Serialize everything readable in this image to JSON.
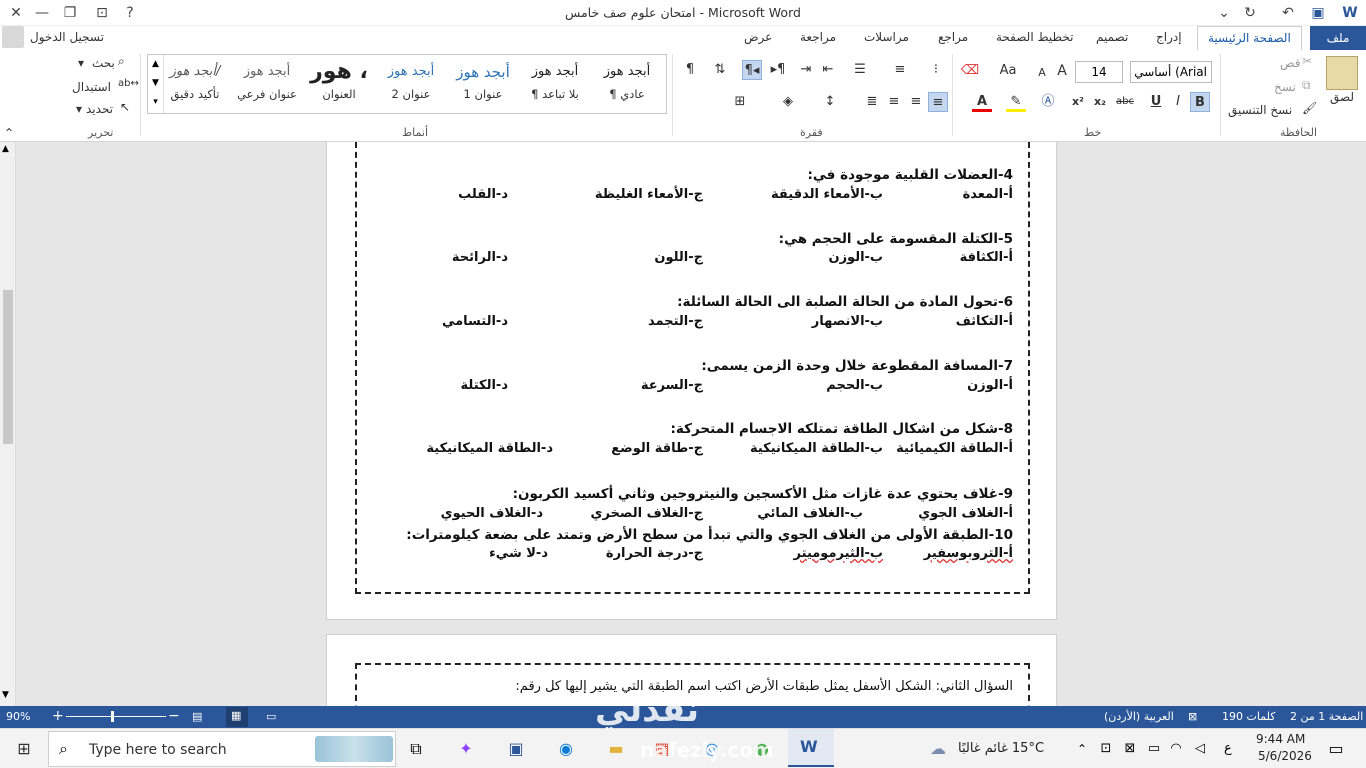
{
  "window": {
    "title": "امتحان علوم صف خامس  -  Microsoft Word",
    "sign_in": "تسجيل الدخول",
    "minimize_glyph": "—",
    "restore_glyph": "❐",
    "close_glyph": "✕",
    "help_glyph": "?"
  },
  "tabs": {
    "file": "ملف",
    "home": "الصفحة الرئيسية",
    "insert": "إدراج",
    "design": "تصميم",
    "layout": "تخطيط الصفحة",
    "references": "مراجع",
    "mailings": "مراسلات",
    "review": "مراجعة",
    "view": "عرض"
  },
  "ribbon": {
    "clipboard": {
      "label": "الحافظة",
      "paste": "لصق",
      "cut": "قص",
      "copy": "نسخ",
      "format_painter": "نسخ التنسيق"
    },
    "font": {
      "label": "خط",
      "name": "أساسي (Arial",
      "size": "14",
      "bold": "B",
      "italic": "I",
      "underline": "U",
      "strike": "abc",
      "sub": "x₂",
      "sup": "x²",
      "grow": "A",
      "shrink": "A",
      "case": "Aa"
    },
    "paragraph": {
      "label": "فقرة"
    },
    "styles": {
      "label": "أنماط",
      "items": [
        {
          "preview": "أبجد هوز",
          "name": "¶ عادي"
        },
        {
          "preview": "أبجد هوز",
          "name": "¶ بلا تباعد"
        },
        {
          "preview": "أبجد هوز",
          "name": "عنوان 1"
        },
        {
          "preview": "أبجد هوز",
          "name": "عنوان 2"
        },
        {
          "preview": "هور ،",
          "name": "العنوان"
        },
        {
          "preview": "أبجد هوز",
          "name": "عنوان فرعي"
        },
        {
          "preview": "أبجد هوز/",
          "name": "تأكيد دقيق"
        }
      ]
    },
    "editing": {
      "label": "تحرير",
      "find": "بحث",
      "replace": "استبدال",
      "select": "تحديد"
    }
  },
  "document": {
    "questions": [
      {
        "text": "4-العضلات القلبية موجودة في:",
        "options": [
          "أ-المعدة",
          "ب-الأمعاء الدقيقة",
          "ج-الأمعاء الغليظة",
          "د-القلب"
        ]
      },
      {
        "text": "5-الكتلة المقسومة على الحجم هي:",
        "options": [
          "أ-الكثافة",
          "ب-الوزن",
          "ج-اللون",
          "د-الرائحة"
        ]
      },
      {
        "text": "6-تحول المادة من الحالة الصلبة الى الحالة السائلة:",
        "options": [
          "أ-التكاثف",
          "ب-الانصهار",
          "ج-التجمد",
          "د-التسامي"
        ]
      },
      {
        "text": "7-المسافة المقطوعة خلال وحدة الزمن يسمى:",
        "options": [
          "أ-الوزن",
          "ب-الحجم",
          "ج-السرعة",
          "د-الكتلة"
        ]
      },
      {
        "text": "8-شكل من اشكال الطاقة تمتلكه الاجسام المتحركة:",
        "options": [
          "أ-الطاقة الكيميائية",
          "ب-الطاقة الميكانيكية",
          "ج-طاقة الوضع",
          "د-الطاقة الميكانيكية"
        ]
      },
      {
        "text": "9-غلاف يحتوي عدة غازات مثل الأكسجين والنيتروجين وثاني أكسيد الكربون:",
        "options": [
          "أ-الغلاف الجوي",
          "ب-الغلاف المائي",
          "ج-الغلاف الصخري",
          "د-الغلاف الحيوي"
        ]
      },
      {
        "text": "10-الطبقة الأولى من الغلاف الجوي والتي تبدأ من سطح الأرض وتمتد على بضعة كيلومترات:",
        "options": [
          "أ-التروبوسفير",
          "ب-الثيرموميتر",
          "ج-درجة الحرارة",
          "د-لا شيء"
        ]
      }
    ],
    "page2_heading": "السؤال الثاني: الشكل الأسفل يمثل طبقات الأرض اكتب اسم الطبقة التي يشير إليها كل رقم:"
  },
  "statusbar": {
    "page": "الصفحة 1 من 2",
    "words": "190 كلمات",
    "language": "العربية (الأردن)",
    "zoom": "90%",
    "zoom_fraction": 0.45
  },
  "taskbar": {
    "search_placeholder": "Type here to search",
    "weather": "15°C  غائم غالبًا",
    "time": "9:44 AM",
    "date": "5/6/2026",
    "lang": "ع"
  },
  "watermark": {
    "logo_ar": "نفذلي",
    "logo_en": "nafezly.com"
  },
  "colors": {
    "word_blue": "#2b579a",
    "spell_red": "#d33"
  }
}
